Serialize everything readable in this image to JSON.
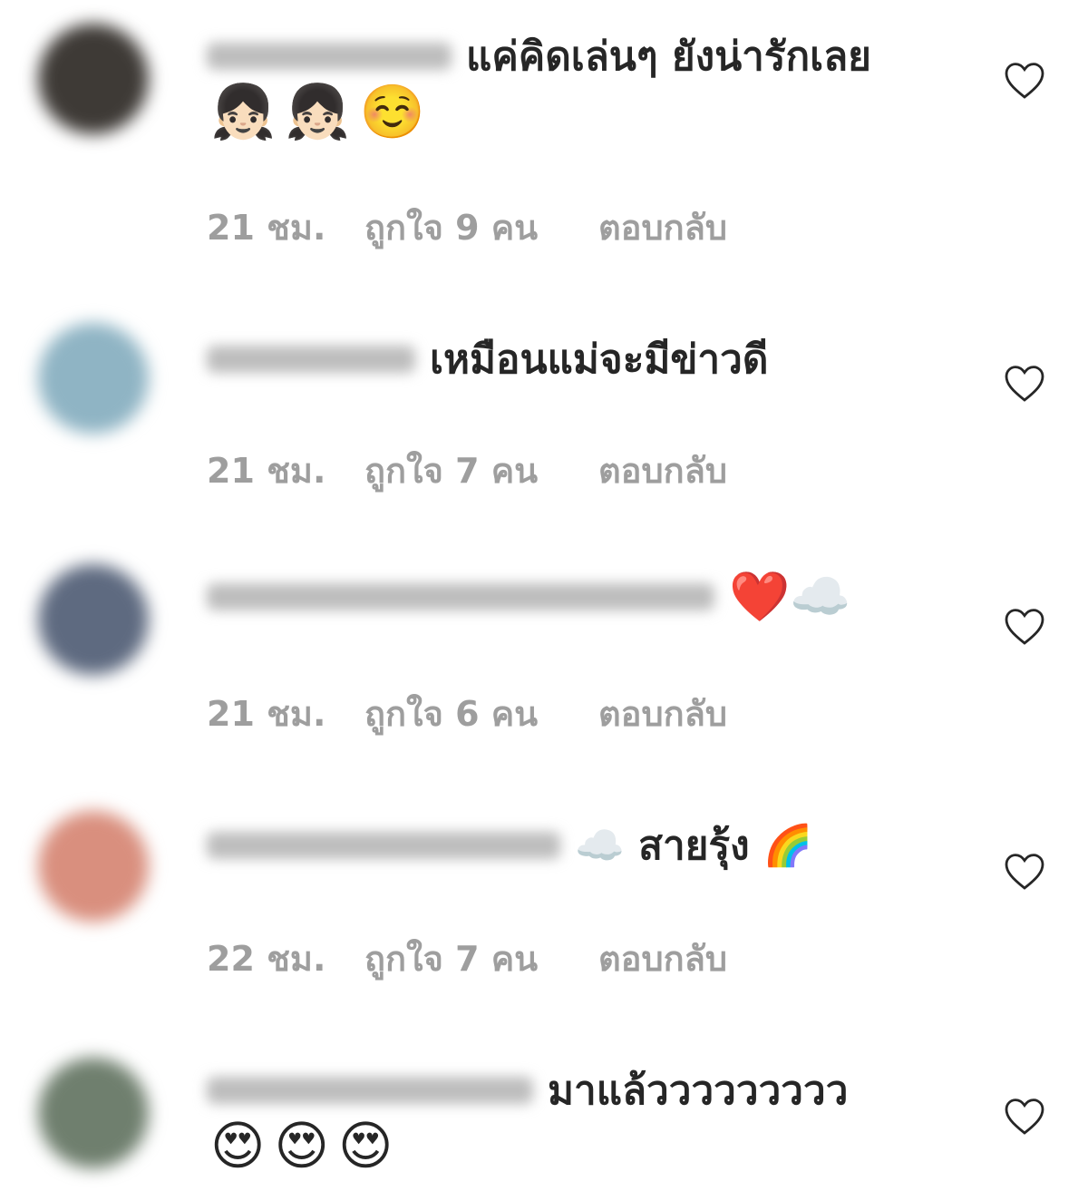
{
  "comments": [
    {
      "text": "แค่คิดเล่นๆ ยังน่ารักเลย",
      "emojis": [
        "👧🏻",
        "👧🏻",
        "☺️"
      ],
      "time": "21 ชม.",
      "likes": "ถูกใจ 9 คน",
      "reply": "ตอบกลับ",
      "avatar_color": "#3e3a36"
    },
    {
      "text": "เหมือนแม่จะมีข่าวดี",
      "emojis": [],
      "time": "21 ชม.",
      "likes": "ถูกใจ 7 คน",
      "reply": "ตอบกลับ",
      "avatar_color": "#8fb4c4"
    },
    {
      "text": "❤️☁️",
      "emojis": [],
      "time": "21 ชม.",
      "likes": "ถูกใจ 6 คน",
      "reply": "ตอบกลับ",
      "avatar_color": "#5e6a80"
    },
    {
      "text": "☁️ สายรุ้ง 🌈",
      "emojis": [],
      "time": "22 ชม.",
      "likes": "ถูกใจ 7 คน",
      "reply": "ตอบกลับ",
      "avatar_color": "#d98f7e"
    },
    {
      "text": "มาแล้ววววววววว",
      "emojis": [
        "😍",
        "😍",
        "😍"
      ],
      "time": "",
      "likes": "",
      "reply": "",
      "avatar_color": "#6f7f6e"
    }
  ],
  "icons": {
    "like": "heart-outline-icon"
  },
  "colors": {
    "text": "#262626",
    "meta": "#9e9e9e",
    "heart_stroke": "#262626"
  }
}
